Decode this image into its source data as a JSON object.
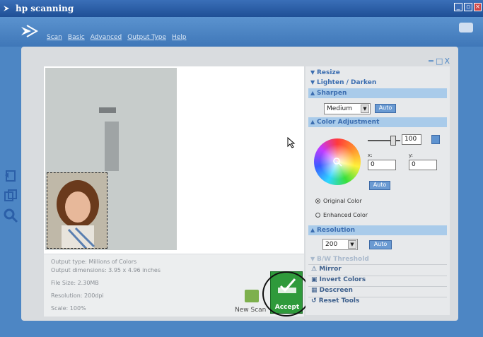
{
  "window": {
    "title": "hp scanning",
    "controls": [
      "minimize",
      "restore",
      "close"
    ]
  },
  "menu": {
    "items": [
      "Scan",
      "Basic",
      "Advanced",
      "Output Type",
      "Help"
    ]
  },
  "panel": {
    "controls": "=□X"
  },
  "info": {
    "output_type": "Output type: Millions of Colors",
    "output_dimensions": "Output dimensions: 3.95 x 4.96 inches",
    "file_size": "File Size: 2.30MB",
    "resolution": "Resolution: 200dpi",
    "scale": "Scale: 100%"
  },
  "actions": {
    "new_scan_label": "New Scan",
    "accept_label": "Accept"
  },
  "sidebar": {
    "resize": "Resize",
    "lighten_darken": "Lighten / Darken",
    "sharpen": {
      "label": "Sharpen",
      "level": "Medium",
      "auto": "Auto"
    },
    "color_adjustment": {
      "label": "Color Adjustment",
      "saturation_value": "100",
      "x_label": "x:",
      "y_label": "y:",
      "x_value": "0",
      "y_value": "0",
      "auto": "Auto",
      "original_color": "Original Color",
      "enhanced_color": "Enhanced Color"
    },
    "resolution": {
      "label": "Resolution",
      "value": "200",
      "auto": "Auto"
    },
    "bw_threshold": "B/W Threshold",
    "mirror": "Mirror",
    "invert_colors": "Invert Colors",
    "descreen": "Descreen",
    "reset_tools": "Reset Tools"
  },
  "icons": {
    "app_logo": "scanner-logo-icon",
    "hp_brand": "hp-brand-icon",
    "tools": [
      "rotate-icon",
      "copy-icon",
      "zoom-icon"
    ]
  }
}
